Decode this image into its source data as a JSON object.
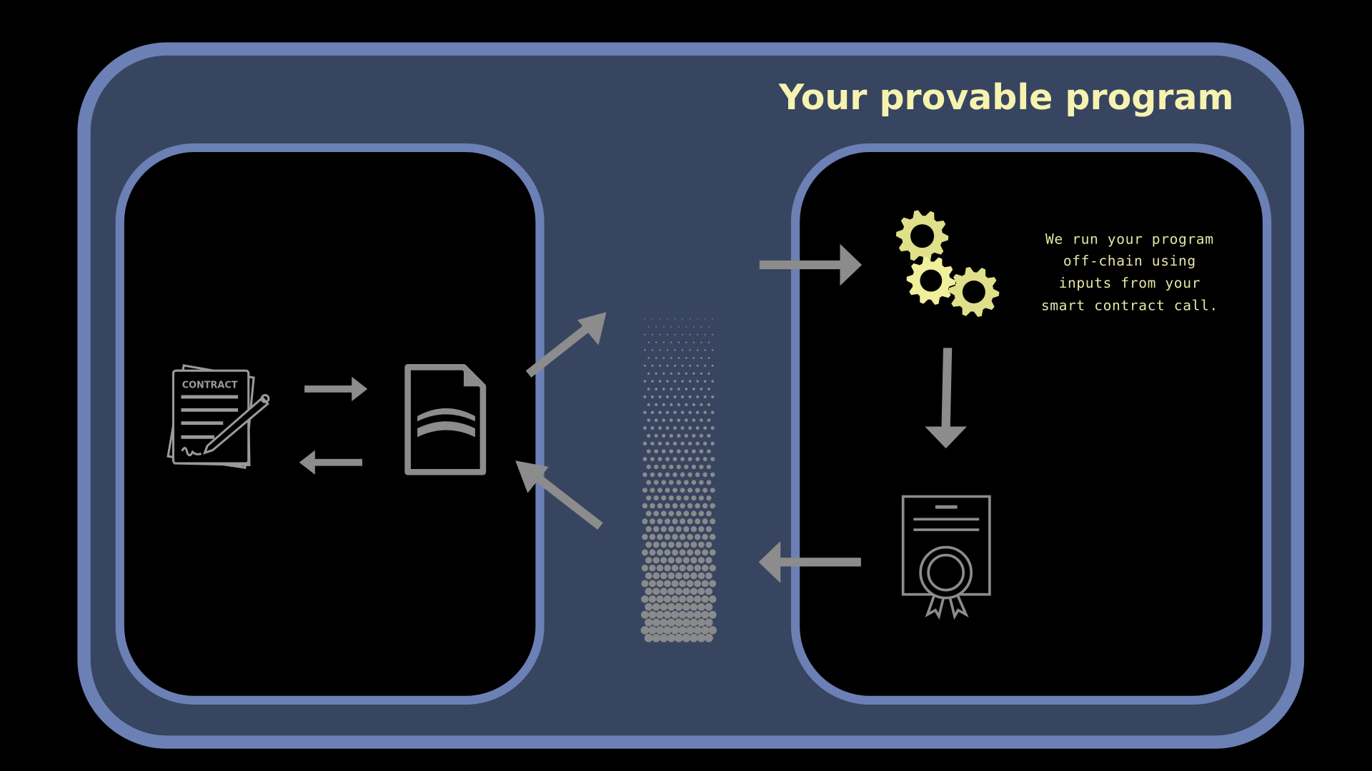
{
  "title": "Your provable program",
  "description_lines": [
    "We run your program",
    "off-chain using",
    "inputs from your",
    "smart contract call."
  ],
  "contract_icon_label": "CONTRACT",
  "colors": {
    "background": "#000000",
    "outer_fill": "#384560",
    "border": "#6b80b5",
    "accent_text": "#f6f3b0",
    "arrow": "#8c8c8c",
    "gear": "#e0df8a"
  }
}
